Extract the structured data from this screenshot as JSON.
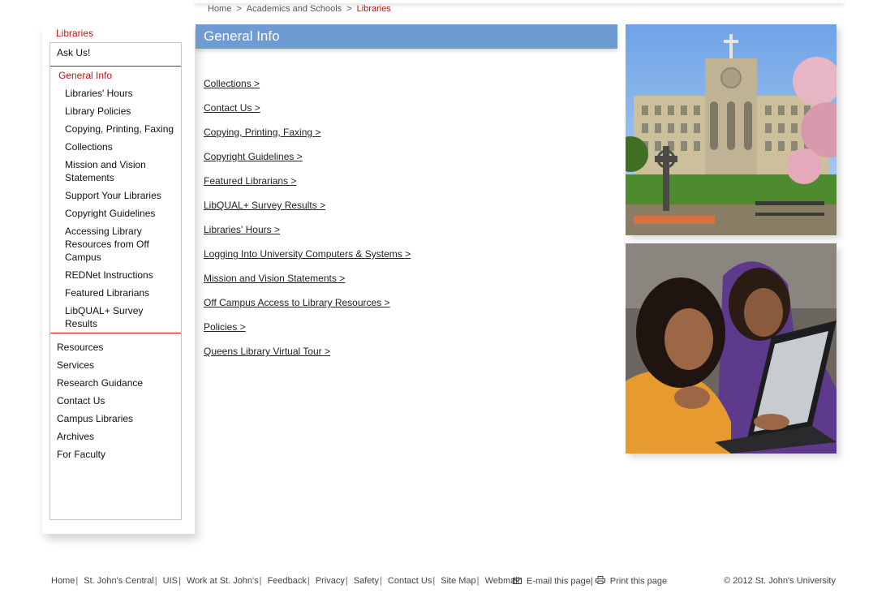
{
  "header": {
    "breadcrumb": [
      {
        "label": "Home"
      },
      {
        "label": "Academics and Schools"
      },
      {
        "label": "Libraries"
      }
    ],
    "breadcrumb_separator": ">"
  },
  "sidebar": {
    "heading": "Libraries",
    "ask_us": "Ask Us!",
    "active_section": "General Info",
    "sub_items": [
      "Libraries' Hours",
      "Library Policies",
      "Copying, Printing, Faxing",
      "Collections",
      "Mission and Vision Statements",
      "Support Your Libraries",
      "Copyright Guidelines",
      "Accessing Library Resources from Off Campus",
      "REDNet Instructions",
      "Featured Librarians",
      "LibQUAL+ Survey Results"
    ],
    "sections": [
      "Resources",
      "Services",
      "Research Guidance",
      "Contact Us",
      "Campus Libraries",
      "Archives",
      "For Faculty"
    ]
  },
  "main": {
    "title": "General Info",
    "links": [
      "Collections  >",
      "Contact Us >",
      "Copying, Printing, Faxing >",
      "Copyright Guidelines >",
      "Featured Librarians >",
      "LibQUAL+ Survey Results >",
      "Libraries' Hours >",
      "Logging Into University Computers & Systems >",
      "Mission and Vision Statements >",
      "Off Campus Access to Library Resources >",
      "Policies >",
      "Queens Library Virtual Tour >"
    ]
  },
  "photos": [
    {
      "subject": "campus building with bell tower and celtic cross"
    },
    {
      "subject": "two students working on a laptop"
    }
  ],
  "footer": {
    "links": [
      "Home",
      "St. John's Central",
      "UIS",
      "Work at St. John's",
      "Feedback",
      "Privacy",
      "Safety",
      "Contact Us",
      "Site Map",
      "Webmail"
    ],
    "email_label": "E-mail this page",
    "print_label": "Print this page",
    "copyright": "© 2012 St. John's University"
  },
  "colors": {
    "accent_red": "#cc1111",
    "title_bar_blue": "#6f9bd3"
  },
  "icons": [
    "envelope-icon",
    "printer-icon"
  ]
}
